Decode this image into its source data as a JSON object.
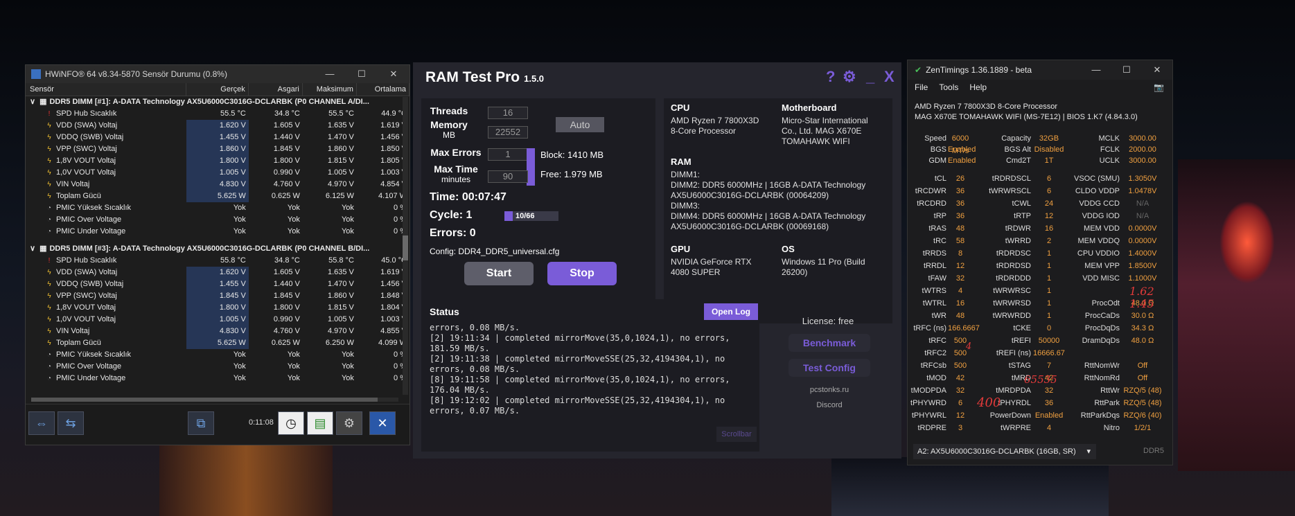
{
  "hwinfo": {
    "title": "HWiNFO® 64 v8.34-5870 Sensör Durumu (0.8%)",
    "headers": [
      "Sensör",
      "Gerçek",
      "Asgari",
      "Maksimum",
      "Ortalama"
    ],
    "group1": "DDR5 DIMM [#1]: A-DATA Technology AX5U6000C3016G-DCLARBK (P0 CHANNEL A/DI...",
    "group2": "DDR5 DIMM [#3]: A-DATA Technology AX5U6000C3016G-DCLARBK (P0 CHANNEL B/DI...",
    "rows1": [
      [
        "SPD Hub Sıcaklık",
        "55.5 °C",
        "34.8 °C",
        "55.5 °C",
        "44.9 °C"
      ],
      [
        "VDD (SWA) Voltaj",
        "1.620 V",
        "1.605 V",
        "1.635 V",
        "1.619 V"
      ],
      [
        "VDDQ (SWB) Voltaj",
        "1.455 V",
        "1.440 V",
        "1.470 V",
        "1.456 V"
      ],
      [
        "VPP (SWC) Voltaj",
        "1.860 V",
        "1.845 V",
        "1.860 V",
        "1.850 V"
      ],
      [
        "1,8V VOUT Voltaj",
        "1.800 V",
        "1.800 V",
        "1.815 V",
        "1.805 V"
      ],
      [
        "1,0V VOUT Voltaj",
        "1.005 V",
        "0.990 V",
        "1.005 V",
        "1.003 V"
      ],
      [
        "VIN Voltaj",
        "4.830 V",
        "4.760 V",
        "4.970 V",
        "4.854 V"
      ],
      [
        "Toplam Gücü",
        "5.625 W",
        "0.625 W",
        "6.125 W",
        "4.107 W"
      ],
      [
        "PMIC Yüksek Sıcaklık",
        "Yok",
        "Yok",
        "Yok",
        "0 %"
      ],
      [
        "PMIC Over Voltage",
        "Yok",
        "Yok",
        "Yok",
        "0 %"
      ],
      [
        "PMIC Under Voltage",
        "Yok",
        "Yok",
        "Yok",
        "0 %"
      ]
    ],
    "rows2": [
      [
        "SPD Hub Sıcaklık",
        "55.8 °C",
        "34.8 °C",
        "55.8 °C",
        "45.0 °C"
      ],
      [
        "VDD (SWA) Voltaj",
        "1.620 V",
        "1.605 V",
        "1.635 V",
        "1.619 V"
      ],
      [
        "VDDQ (SWB) Voltaj",
        "1.455 V",
        "1.440 V",
        "1.470 V",
        "1.456 V"
      ],
      [
        "VPP (SWC) Voltaj",
        "1.845 V",
        "1.845 V",
        "1.860 V",
        "1.848 V"
      ],
      [
        "1,8V VOUT Voltaj",
        "1.800 V",
        "1.800 V",
        "1.815 V",
        "1.804 V"
      ],
      [
        "1,0V VOUT Voltaj",
        "1.005 V",
        "0.990 V",
        "1.005 V",
        "1.003 V"
      ],
      [
        "VIN Voltaj",
        "4.830 V",
        "4.760 V",
        "4.970 V",
        "4.855 V"
      ],
      [
        "Toplam Gücü",
        "5.625 W",
        "0.625 W",
        "6.250 W",
        "4.099 W"
      ],
      [
        "PMIC Yüksek Sıcaklık",
        "Yok",
        "Yok",
        "Yok",
        "0 %"
      ],
      [
        "PMIC Over Voltage",
        "Yok",
        "Yok",
        "Yok",
        "0 %"
      ],
      [
        "PMIC Under Voltage",
        "Yok",
        "Yok",
        "Yok",
        "0 %"
      ]
    ],
    "elapsed": "0:11:08"
  },
  "ramtest": {
    "title": "RAM Test Pro",
    "version": "1.5.0",
    "threads_label": "Threads",
    "threads": "16",
    "memory_label": "Memory",
    "memory_unit": "MB",
    "memory": "22552",
    "maxerr_label": "Max Errors",
    "maxerr": "1",
    "maxtime_label": "Max Time",
    "maxtime_unit": "minutes",
    "maxtime": "90",
    "auto": "Auto",
    "block": "Block:   1410 MB",
    "free": "Free:  1.979 MB",
    "time": "Time:   00:07:47",
    "cycle": "Cycle:   1",
    "cycle_progress": "10/66",
    "cycle_fraction": 0.15,
    "errors": "Errors:   0",
    "config": "Config: DDR4_DDR5_universal.cfg",
    "start": "Start",
    "stop": "Stop",
    "cpu_h": "CPU",
    "cpu": "AMD Ryzen 7 7800X3D 8-Core Processor",
    "mb_h": "Motherboard",
    "mb": "Micro-Star International Co., Ltd. MAG X670E TOMAHAWK WIFI",
    "ram_h": "RAM",
    "ram": "DIMM1:\nDIMM2: DDR5 6000MHz | 16GB A-DATA Technology AX5U6000C3016G-DCLARBK (00064209)\nDIMM3:\nDIMM4: DDR5 6000MHz | 16GB A-DATA Technology AX5U6000C3016G-DCLARBK (00069168)",
    "gpu_h": "GPU",
    "gpu": "NVIDIA GeForce RTX 4080 SUPER",
    "os_h": "OS",
    "os": "Windows 11 Pro (Build 26200)",
    "status_h": "Status",
    "openlog": "Open Log",
    "log": "errors, 0.08 MB/s.\n[2] 19:11:34 | completed mirrorMove(35,0,1024,1), no errors,\n181.59 MB/s.\n[2] 19:11:38 | completed mirrorMoveSSE(25,32,4194304,1), no\nerrors, 0.08 MB/s.\n[8] 19:11:58 | completed mirrorMove(35,0,1024,1), no errors,\n176.04 MB/s.\n[8] 19:12:02 | completed mirrorMoveSSE(25,32,4194304,1), no\nerrors, 0.07 MB/s.",
    "scrollbar": "Scrollbar",
    "license": "License: free",
    "benchmark": "Benchmark",
    "testconfig": "Test Config",
    "site": "pcstonks.ru",
    "discord": "Discord"
  },
  "zen": {
    "title": "ZenTimings 1.36.1889 - beta",
    "menu": [
      "File",
      "Tools",
      "Help"
    ],
    "cpu": "AMD Ryzen 7 7800X3D 8-Core Processor",
    "board": "MAG X670E TOMAHAWK WIFI (MS-7E12) | BIOS 1.K7 (4.84.3.0)",
    "top": [
      [
        "Speed",
        "6000 MT/s",
        "Capacity",
        "32GB",
        "MCLK",
        "3000.00"
      ],
      [
        "BGS",
        "Enabled",
        "BGS Alt",
        "Disabled",
        "FCLK",
        "2000.00"
      ],
      [
        "GDM",
        "Enabled",
        "Cmd2T",
        "1T",
        "UCLK",
        "3000.00"
      ]
    ],
    "rows": [
      [
        "tCL",
        "26",
        "tRDRDSCL",
        "6",
        "VSOC (SMU)",
        "1.3050V"
      ],
      [
        "tRCDWR",
        "36",
        "tWRWRSCL",
        "6",
        "CLDO VDDP",
        "1.0478V"
      ],
      [
        "tRCDRD",
        "36",
        "tCWL",
        "24",
        "VDDG CCD",
        "N/A"
      ],
      [
        "tRP",
        "36",
        "tRTP",
        "12",
        "VDDG IOD",
        "N/A"
      ],
      [
        "tRAS",
        "48",
        "tRDWR",
        "16",
        "MEM VDD",
        "0.0000V"
      ],
      [
        "tRC",
        "58",
        "tWRRD",
        "2",
        "MEM VDDQ",
        "0.0000V"
      ],
      [
        "tRRDS",
        "8",
        "tRDRDSC",
        "1",
        "CPU VDDIO",
        "1.4000V"
      ],
      [
        "tRRDL",
        "12",
        "tRDRDSD",
        "1",
        "MEM VPP",
        "1.8500V"
      ],
      [
        "tFAW",
        "32",
        "tRDRDDD",
        "1",
        "VDD MISC",
        "1.1000V"
      ],
      [
        "tWTRS",
        "4",
        "tWRWRSC",
        "1",
        "",
        ""
      ],
      [
        "tWTRL",
        "16",
        "tWRWRSD",
        "1",
        "ProcOdt",
        "48.0 Ω"
      ],
      [
        "tWR",
        "48",
        "tWRWRDD",
        "1",
        "ProcCaDs",
        "30.0 Ω"
      ],
      [
        "tRFC (ns)",
        "166.6667",
        "tCKE",
        "0",
        "ProcDqDs",
        "34.3 Ω"
      ],
      [
        "tRFC",
        "500",
        "tREFI",
        "50000",
        "DramDqDs",
        "48.0 Ω"
      ],
      [
        "tRFC2",
        "500",
        "tREFI (ns)",
        "16666.67",
        "",
        ""
      ],
      [
        "tRFCsb",
        "500",
        "tSTAG",
        "7",
        "RttNomWr",
        "Off"
      ],
      [
        "tMOD",
        "42",
        "tMRD",
        "42",
        "RttNomRd",
        "Off"
      ],
      [
        "tMODPDA",
        "32",
        "tMRDPDA",
        "32",
        "RttWr",
        "RZQ/5 (48)"
      ],
      [
        "tPHYWRD",
        "6",
        "tPHYRDL",
        "36",
        "RttPark",
        "RZQ/5 (48)"
      ],
      [
        "tPHYWRL",
        "12",
        "PowerDown",
        "Enabled",
        "RttParkDqs",
        "RZQ/6 (40)"
      ],
      [
        "tRDPRE",
        "3",
        "tWRPRE",
        "4",
        "Nitro",
        "1/2/1"
      ]
    ],
    "dimm": "A2: AX5U6000C3016G-DCLARBK (16GB, SR)",
    "ddr": "DDR5",
    "notes": [
      "1.62",
      "1.45",
      "4",
      "400",
      "65535"
    ]
  }
}
